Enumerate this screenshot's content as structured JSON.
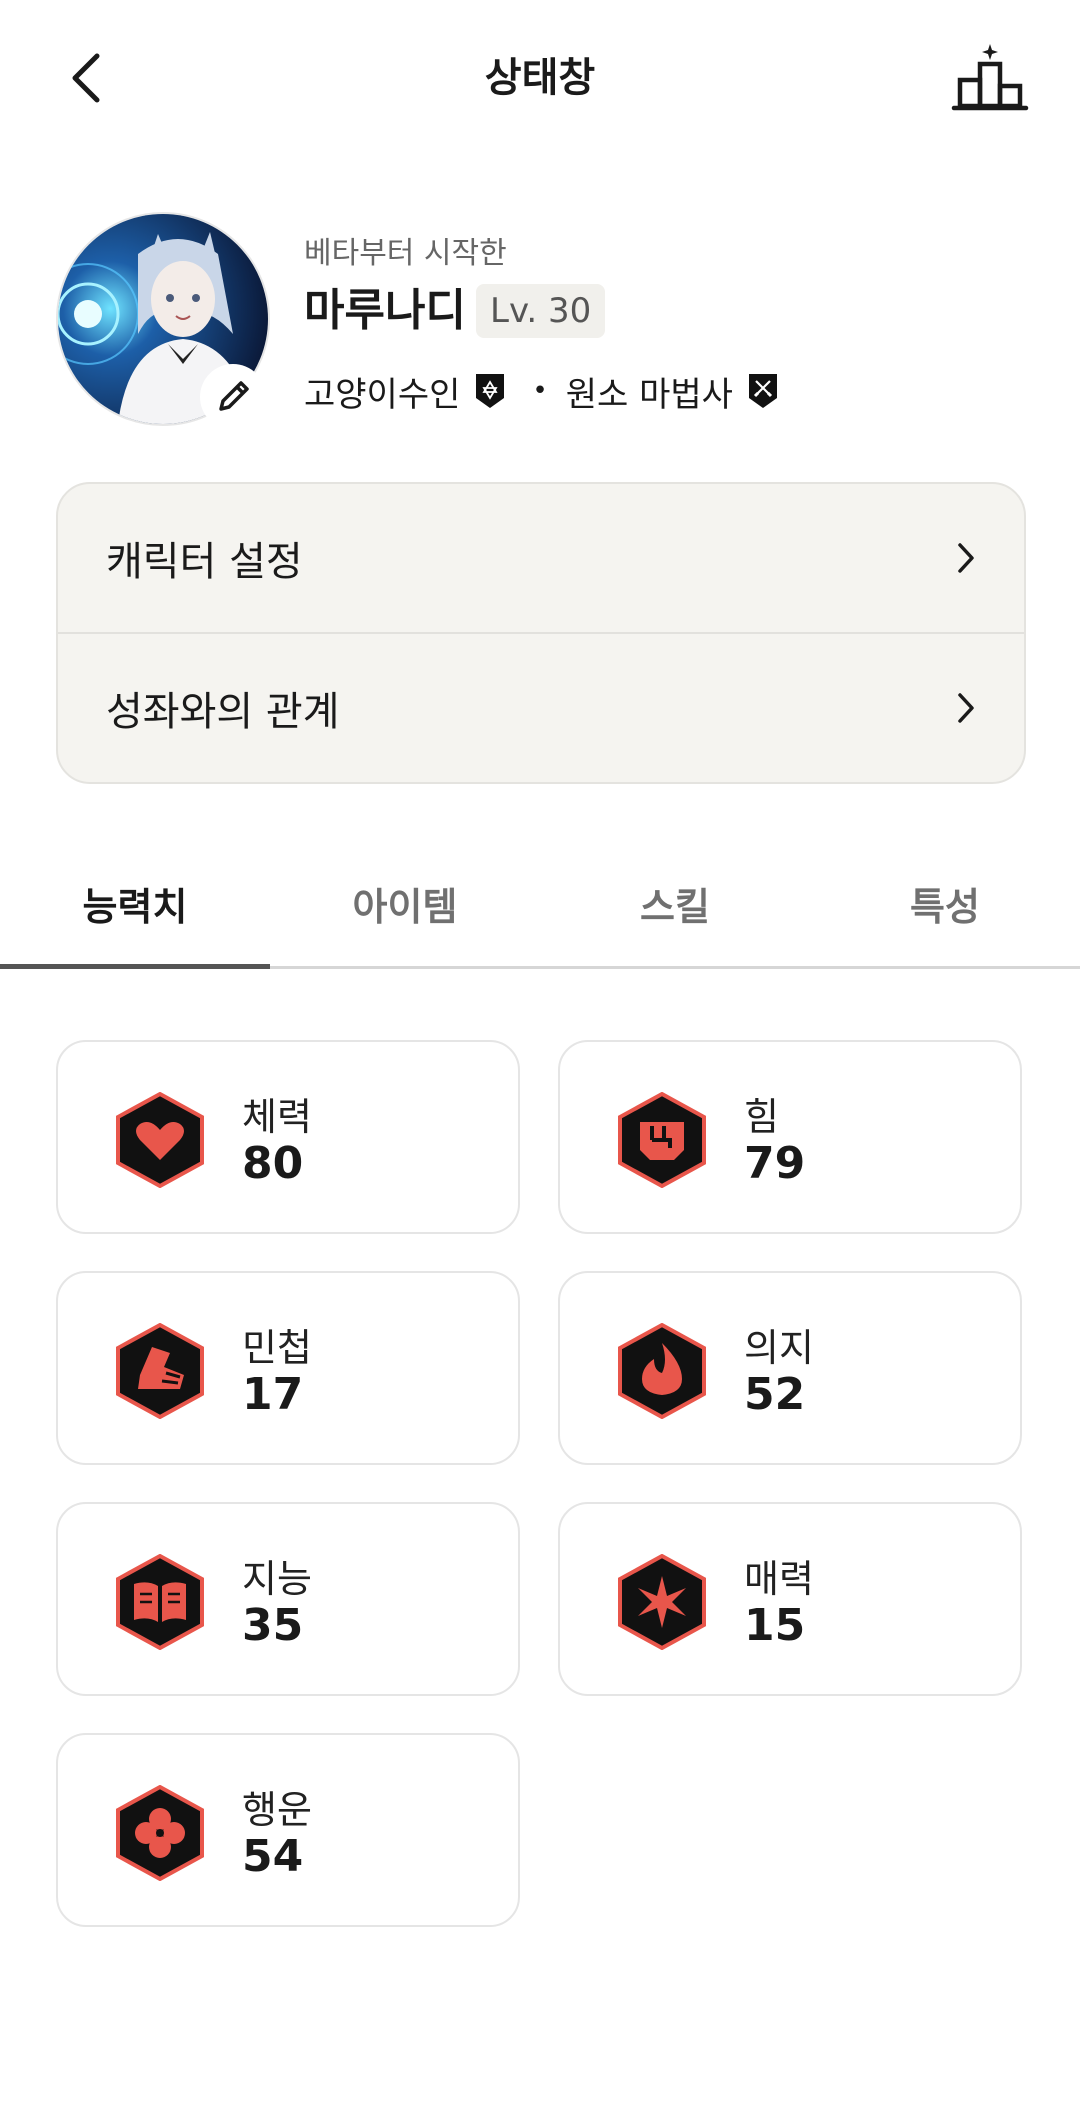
{
  "header": {
    "title": "상태창",
    "back_icon": "chevron-left-icon",
    "rank_icon": "podium-sparkle-icon"
  },
  "profile": {
    "subtitle": "베타부터 시작한",
    "name": "마루나디",
    "level": "Lv. 30",
    "race": "고양이수인",
    "class": "원소 마법사",
    "separator": "•"
  },
  "menu": [
    {
      "label": "캐릭터 설정"
    },
    {
      "label": "성좌와의 관계"
    }
  ],
  "tabs": [
    {
      "label": "능력치",
      "active": true
    },
    {
      "label": "아이템",
      "active": false
    },
    {
      "label": "스킬",
      "active": false
    },
    {
      "label": "특성",
      "active": false
    }
  ],
  "stats": [
    {
      "name": "체력",
      "value": "80",
      "icon": "heart-icon"
    },
    {
      "name": "힘",
      "value": "79",
      "icon": "fist-icon"
    },
    {
      "name": "민첩",
      "value": "17",
      "icon": "boot-icon"
    },
    {
      "name": "의지",
      "value": "52",
      "icon": "flame-icon"
    },
    {
      "name": "지능",
      "value": "35",
      "icon": "book-icon"
    },
    {
      "name": "매력",
      "value": "15",
      "icon": "sparkle-icon"
    },
    {
      "name": "행운",
      "value": "54",
      "icon": "clover-icon"
    }
  ],
  "colors": {
    "accent": "#e8564b",
    "icon_bg": "#111111",
    "card_bg": "#f5f4f0"
  }
}
